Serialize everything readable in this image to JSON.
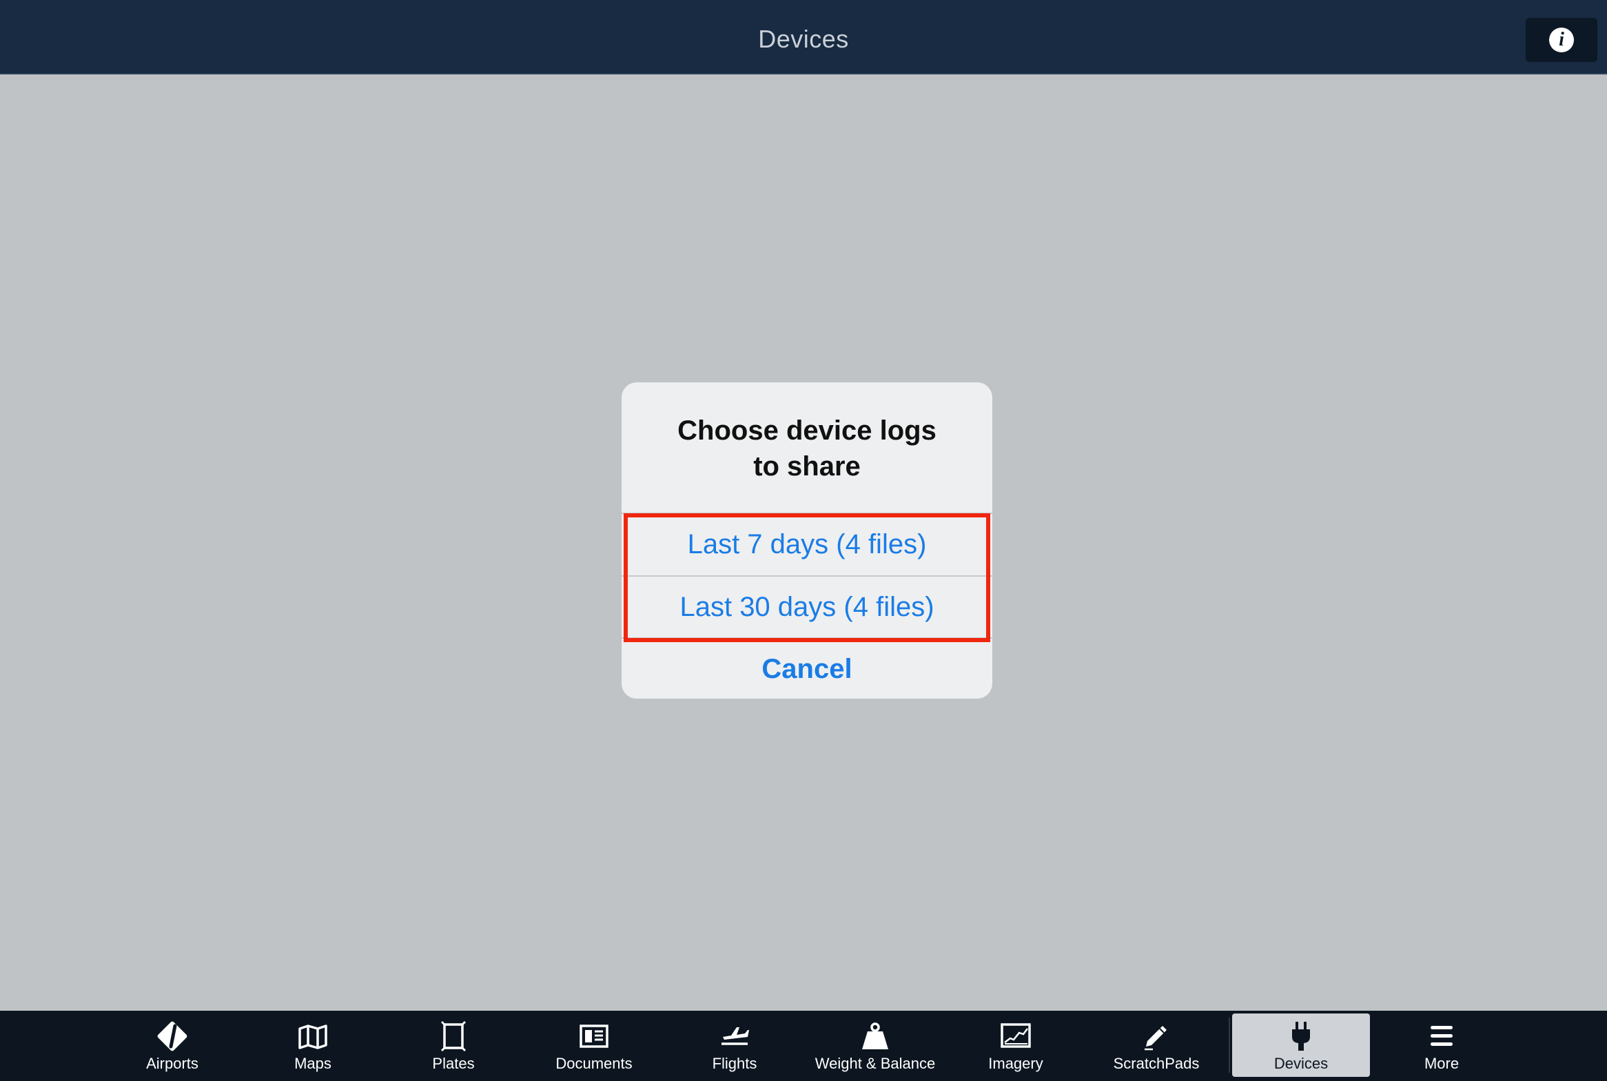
{
  "header": {
    "title": "Devices",
    "info_icon": "i"
  },
  "dialog": {
    "title_line1": "Choose device logs",
    "title_line2": "to share",
    "actions": [
      {
        "label": "Last 7 days (4 files)"
      },
      {
        "label": "Last 30 days (4 files)"
      }
    ],
    "cancel_label": "Cancel"
  },
  "colors": {
    "accent": "#1a7ce6",
    "highlight": "#f0260e",
    "topbar": "#182b42",
    "tabbar": "#0d1620",
    "background": "#bfc3c6"
  },
  "tabbar": {
    "tabs": [
      {
        "label": "Airports",
        "icon": "airport-icon"
      },
      {
        "label": "Maps",
        "icon": "map-icon"
      },
      {
        "label": "Plates",
        "icon": "plates-icon"
      },
      {
        "label": "Documents",
        "icon": "documents-icon"
      },
      {
        "label": "Flights",
        "icon": "flights-icon"
      },
      {
        "label": "Weight & Balance",
        "icon": "weight-icon"
      },
      {
        "label": "Imagery",
        "icon": "imagery-icon"
      },
      {
        "label": "ScratchPads",
        "icon": "pencil-icon"
      },
      {
        "label": "Devices",
        "icon": "plug-icon",
        "active": true
      },
      {
        "label": "More",
        "icon": "menu-icon"
      }
    ]
  }
}
